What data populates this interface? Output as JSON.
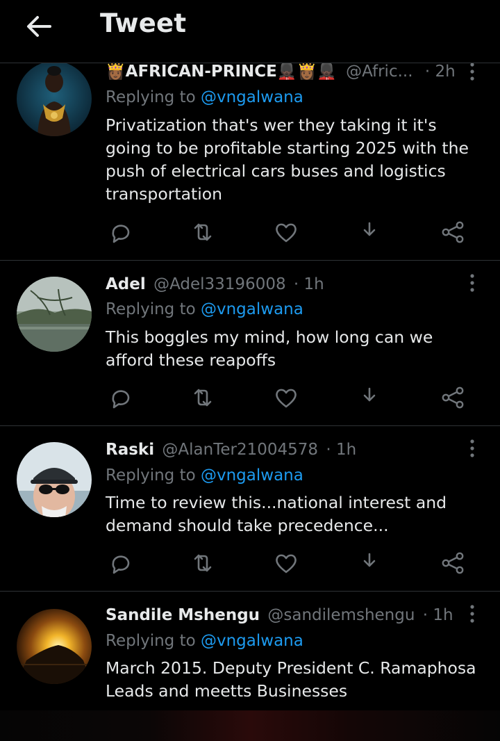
{
  "header": {
    "title": "Tweet",
    "back_icon": "arrow-left-icon"
  },
  "colors": {
    "background": "#000000",
    "text": "#e7e9ea",
    "muted": "#71767b",
    "link": "#1d9bf0",
    "divider": "#2f3336"
  },
  "action_icons": [
    "reply-icon",
    "retweet-icon",
    "like-icon",
    "download-icon",
    "share-icon"
  ],
  "tweets": [
    {
      "name": "👸🏾AFRICAN-PRINCE💂🏿👸🏾💂🏿",
      "handle": "@Afric...",
      "sep": "·",
      "time": "2h",
      "reply_prefix": "Replying to",
      "mention": "@vngalwana",
      "text": "Privatization that's wer they taking it it's going to be profitable starting 2025 with the push of electrical cars buses and logistics transportation"
    },
    {
      "name": "Adel",
      "handle": "@Adel33196008",
      "sep": "·",
      "time": "1h",
      "reply_prefix": "Replying to",
      "mention": "@vngalwana",
      "text": "This boggles my mind, how long can we afford these reapoffs"
    },
    {
      "name": "Raski",
      "handle": "@AlanTer21004578",
      "sep": "·",
      "time": "1h",
      "reply_prefix": "Replying to",
      "mention": "@vngalwana",
      "text": "Time to review this...national interest and demand should take precedence..."
    },
    {
      "name": "Sandile Mshengu",
      "handle": "@sandilemshengu",
      "sep": "·",
      "time": "1h",
      "reply_prefix": "Replying to",
      "mention": "@vngalwana",
      "text": "March 2015. Deputy President C. Ramaphosa Leads and meetts Businesses"
    }
  ]
}
